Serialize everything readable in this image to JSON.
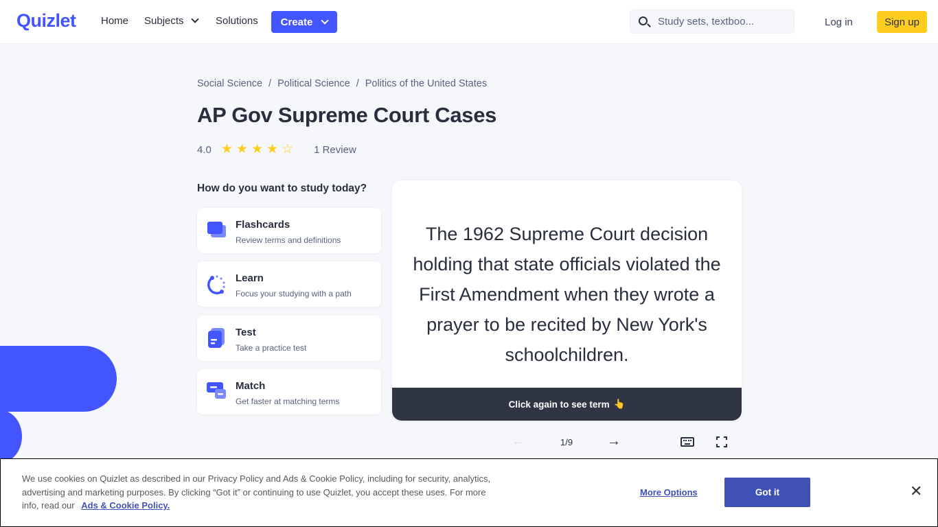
{
  "header": {
    "logo": "Quizlet",
    "nav": {
      "home": "Home",
      "subjects": "Subjects",
      "solutions": "Solutions",
      "create": "Create"
    },
    "search_placeholder": "Study sets, textboo...",
    "login": "Log in",
    "signup": "Sign up"
  },
  "breadcrumb": [
    "Social Science",
    "Political Science",
    "Politics of the United States"
  ],
  "breadcrumb_separator": "/",
  "title": "AP Gov Supreme Court Cases",
  "rating": {
    "value": "4.0",
    "stars_filled": 4,
    "stars_total": 5,
    "reviews": "1 Review"
  },
  "study": {
    "question": "How do you want to study today?",
    "options": [
      {
        "label": "Flashcards",
        "desc": "Review terms and definitions",
        "icon": "flashcards-icon"
      },
      {
        "label": "Learn",
        "desc": "Focus your studying with a path",
        "icon": "learn-icon"
      },
      {
        "label": "Test",
        "desc": "Take a practice test",
        "icon": "test-icon"
      },
      {
        "label": "Match",
        "desc": "Get faster at matching terms",
        "icon": "match-icon"
      }
    ]
  },
  "flashcard": {
    "text": "The 1962 Supreme Court decision holding that state officials violated the First Amendment when they wrote a prayer to be recited by New York's schoolchildren.",
    "footer": "Click again to see term",
    "footer_emoji": "👆",
    "counter": "1/9",
    "prev_icon": "←",
    "next_icon": "→"
  },
  "cookie": {
    "text": "We use cookies on Quizlet as described in our Privacy Policy and Ads & Cookie Policy, including for security, analytics, advertising and marketing purposes. By clicking “Got it” or continuing to use Quizlet, you accept these uses. For more info, read our",
    "link": "Ads & Cookie Policy.",
    "more_options": "More Options",
    "got_it": "Got it",
    "close": "✕"
  },
  "colors": {
    "brand": "#4255ff",
    "signup": "#ffcd1f",
    "cookie_button": "#3f51b5",
    "card_footer": "#303545"
  }
}
